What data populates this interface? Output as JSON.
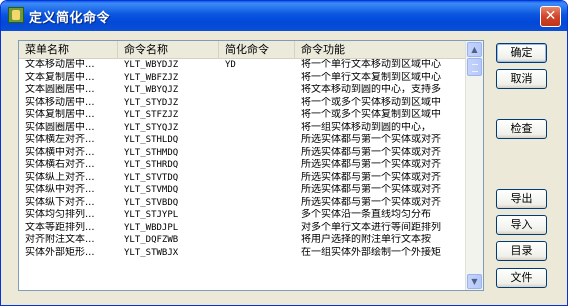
{
  "window": {
    "title": "定义简化命令",
    "close_glyph": "✕"
  },
  "table": {
    "columns": [
      "菜单名称",
      "命令名称",
      "简化命令",
      "命令功能"
    ],
    "rows": [
      [
        "文本移动居中...",
        "YLT_WBYDJZ",
        "YD",
        "将一个单行文本移动到区域中心"
      ],
      [
        "文本复制居中...",
        "YLT_WBFZJZ",
        "",
        "将一个单行文本复制到区域中心"
      ],
      [
        "文本圆圈居中...",
        "YLT_WBYQJZ",
        "",
        "将文本移动到圆的中心，支持多"
      ],
      [
        "实体移动居中...",
        "YLT_STYDJZ",
        "",
        "将一个或多个实体移动到区域中"
      ],
      [
        "实体复制居中...",
        "YLT_STFZJZ",
        "",
        "将一个或多个实体复制到区域中"
      ],
      [
        "实体圆圈居中...",
        "YLT_STYQJZ",
        "",
        "将一组实体移动到圆的中心，"
      ],
      [
        "实体横左对齐...",
        "YLT_STHLDQ",
        "",
        "所选实体都与第一个实体或对齐"
      ],
      [
        "实体横中对齐...",
        "YLT_STHMDQ",
        "",
        "所选实体都与第一个实体或对齐"
      ],
      [
        "实体横右对齐...",
        "YLT_STHRDQ",
        "",
        "所选实体都与第一个实体或对齐"
      ],
      [
        "实体纵上对齐...",
        "YLT_STVTDQ",
        "",
        "所选实体都与第一个实体或对齐"
      ],
      [
        "实体纵中对齐...",
        "YLT_STVMDQ",
        "",
        "所选实体都与第一个实体或对齐"
      ],
      [
        "实体纵下对齐...",
        "YLT_STVBDQ",
        "",
        "所选实体都与第一个实体或对齐"
      ],
      [
        "实体均匀排列...",
        "YLT_STJYPL",
        "",
        "多个实体沿一条直线均匀分布"
      ],
      [
        "文本等距排列...",
        "YLT_WBDJPL",
        "",
        "对多个单行文本进行等间距排列"
      ],
      [
        "对齐附注文本...",
        "YLT_DQFZWB",
        "",
        "将用户选择的附注单行文本按"
      ],
      [
        "实体外部矩形...",
        "YLT_STWBJX",
        "",
        "在一组实体外部绘制一个外接矩"
      ]
    ]
  },
  "scrollbar": {
    "up_glyph": "▲",
    "down_glyph": "▼"
  },
  "buttons": {
    "ok": "确定",
    "cancel": "取消",
    "check": "检查",
    "export": "导出",
    "import": "导入",
    "catalog": "目录",
    "file": "文件"
  }
}
